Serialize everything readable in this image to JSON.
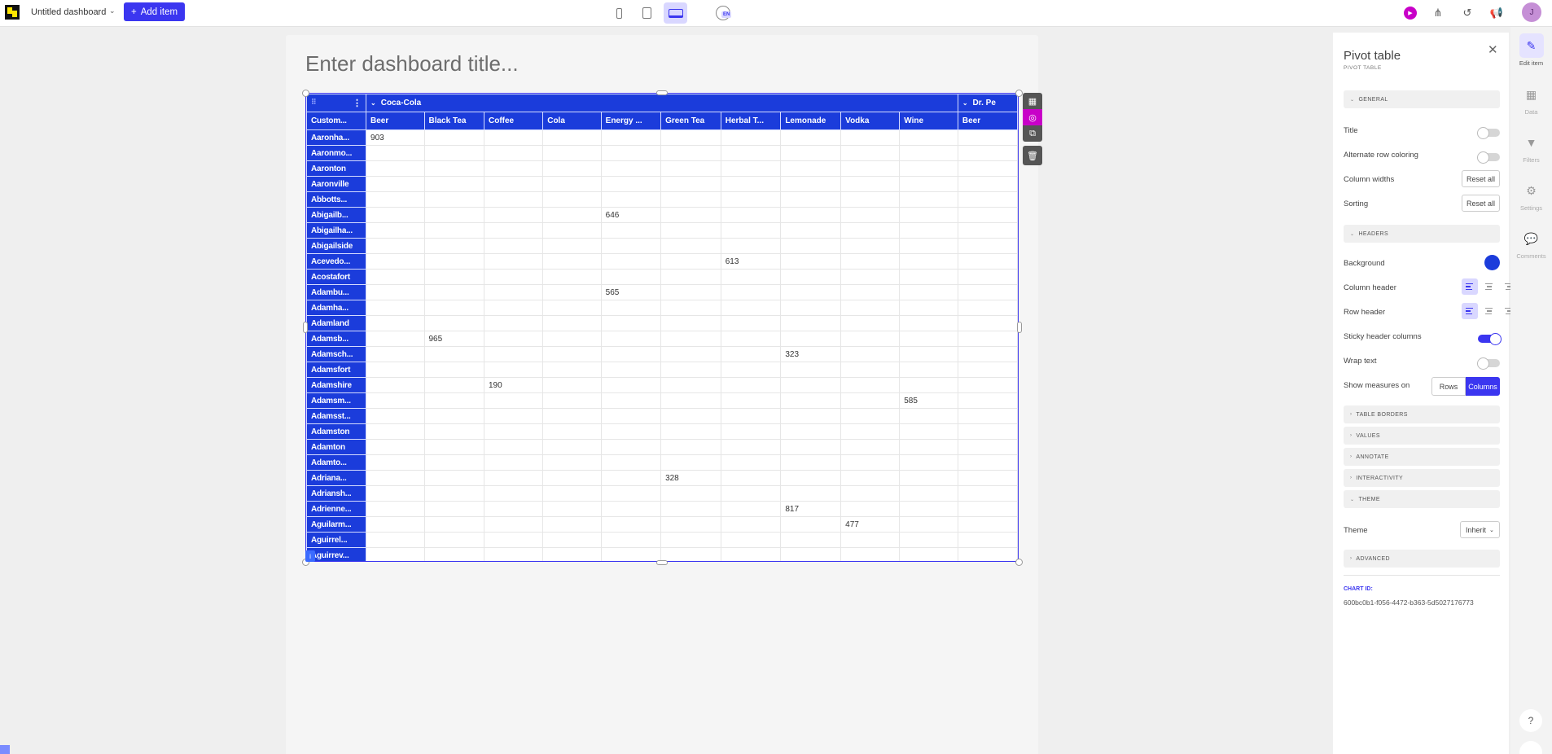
{
  "topbar": {
    "dashboard_name": "Untitled dashboard",
    "add_item_label": "Add item",
    "lang": "EN",
    "avatar_initial": "J"
  },
  "canvas": {
    "title_placeholder": "Enter dashboard title..."
  },
  "pivot": {
    "header_color": "#1b3cdb",
    "corner_label": "Custom...",
    "column_groups": [
      {
        "label": "Coca-Cola",
        "span": 10
      },
      {
        "label": "Dr. Pe",
        "span": 1
      }
    ],
    "measures": [
      "Beer",
      "Black Tea",
      "Coffee",
      "Cola",
      "Energy ...",
      "Green Tea",
      "Herbal T...",
      "Lemonade",
      "Vodka",
      "Wine",
      "Beer"
    ],
    "rows": [
      {
        "label": "Aaronha...",
        "values": [
          "903",
          "",
          "",
          "",
          "",
          "",
          "",
          "",
          "",
          "",
          ""
        ]
      },
      {
        "label": "Aaronmo...",
        "values": [
          "",
          "",
          "",
          "",
          "",
          "",
          "",
          "",
          "",
          "",
          ""
        ]
      },
      {
        "label": "Aaronton",
        "values": [
          "",
          "",
          "",
          "",
          "",
          "",
          "",
          "",
          "",
          "",
          ""
        ]
      },
      {
        "label": "Aaronville",
        "values": [
          "",
          "",
          "",
          "",
          "",
          "",
          "",
          "",
          "",
          "",
          ""
        ]
      },
      {
        "label": "Abbotts...",
        "values": [
          "",
          "",
          "",
          "",
          "",
          "",
          "",
          "",
          "",
          "",
          ""
        ]
      },
      {
        "label": "Abigailb...",
        "values": [
          "",
          "",
          "",
          "",
          "646",
          "",
          "",
          "",
          "",
          "",
          ""
        ]
      },
      {
        "label": "Abigailha...",
        "values": [
          "",
          "",
          "",
          "",
          "",
          "",
          "",
          "",
          "",
          "",
          ""
        ]
      },
      {
        "label": "Abigailside",
        "values": [
          "",
          "",
          "",
          "",
          "",
          "",
          "",
          "",
          "",
          "",
          ""
        ]
      },
      {
        "label": "Acevedo...",
        "values": [
          "",
          "",
          "",
          "",
          "",
          "",
          "613",
          "",
          "",
          "",
          ""
        ]
      },
      {
        "label": "Acostafort",
        "values": [
          "",
          "",
          "",
          "",
          "",
          "",
          "",
          "",
          "",
          "",
          ""
        ]
      },
      {
        "label": "Adambu...",
        "values": [
          "",
          "",
          "",
          "",
          "565",
          "",
          "",
          "",
          "",
          "",
          ""
        ]
      },
      {
        "label": "Adamha...",
        "values": [
          "",
          "",
          "",
          "",
          "",
          "",
          "",
          "",
          "",
          "",
          ""
        ]
      },
      {
        "label": "Adamland",
        "values": [
          "",
          "",
          "",
          "",
          "",
          "",
          "",
          "",
          "",
          "",
          ""
        ]
      },
      {
        "label": "Adamsb...",
        "values": [
          "",
          "965",
          "",
          "",
          "",
          "",
          "",
          "",
          "",
          "",
          ""
        ]
      },
      {
        "label": "Adamsch...",
        "values": [
          "",
          "",
          "",
          "",
          "",
          "",
          "",
          "323",
          "",
          "",
          ""
        ]
      },
      {
        "label": "Adamsfort",
        "values": [
          "",
          "",
          "",
          "",
          "",
          "",
          "",
          "",
          "",
          "",
          ""
        ]
      },
      {
        "label": "Adamshire",
        "values": [
          "",
          "",
          "190",
          "",
          "",
          "",
          "",
          "",
          "",
          "",
          ""
        ]
      },
      {
        "label": "Adamsm...",
        "values": [
          "",
          "",
          "",
          "",
          "",
          "",
          "",
          "",
          "",
          "585",
          ""
        ]
      },
      {
        "label": "Adamsst...",
        "values": [
          "",
          "",
          "",
          "",
          "",
          "",
          "",
          "",
          "",
          "",
          ""
        ]
      },
      {
        "label": "Adamston",
        "values": [
          "",
          "",
          "",
          "",
          "",
          "",
          "",
          "",
          "",
          "",
          ""
        ]
      },
      {
        "label": "Adamton",
        "values": [
          "",
          "",
          "",
          "",
          "",
          "",
          "",
          "",
          "",
          "",
          ""
        ]
      },
      {
        "label": "Adamto...",
        "values": [
          "",
          "",
          "",
          "",
          "",
          "",
          "",
          "",
          "",
          "",
          ""
        ]
      },
      {
        "label": "Adriana...",
        "values": [
          "",
          "",
          "",
          "",
          "",
          "328",
          "",
          "",
          "",
          "",
          ""
        ]
      },
      {
        "label": "Adriansh...",
        "values": [
          "",
          "",
          "",
          "",
          "",
          "",
          "",
          "",
          "",
          "",
          ""
        ]
      },
      {
        "label": "Adrienne...",
        "values": [
          "",
          "",
          "",
          "",
          "",
          "",
          "",
          "817",
          "",
          "",
          ""
        ]
      },
      {
        "label": "Aguilarm...",
        "values": [
          "",
          "",
          "",
          "",
          "",
          "",
          "",
          "",
          "477",
          "",
          ""
        ]
      },
      {
        "label": "Aguirrel...",
        "values": [
          "",
          "",
          "",
          "",
          "",
          "",
          "",
          "",
          "",
          "",
          ""
        ]
      },
      {
        "label": "Aguirrev...",
        "values": [
          "",
          "",
          "",
          "",
          "",
          "",
          "",
          "",
          "",
          "",
          ""
        ]
      }
    ]
  },
  "panel": {
    "title": "Pivot table",
    "subtitle": "PIVOT TABLE",
    "sections": {
      "general": "GENERAL",
      "headers": "HEADERS",
      "table_borders": "TABLE BORDERS",
      "values": "VALUES",
      "annotate": "ANNOTATE",
      "interactivity": "INTERACTIVITY",
      "theme": "THEME",
      "advanced": "ADVANCED"
    },
    "labels": {
      "title": "Title",
      "alternate_row_coloring": "Alternate row coloring",
      "column_widths": "Column widths",
      "sorting": "Sorting",
      "background": "Background",
      "column_header": "Column header",
      "row_header": "Row header",
      "sticky_header_columns": "Sticky header columns",
      "wrap_text": "Wrap text",
      "show_measures_on": "Show measures on",
      "theme": "Theme"
    },
    "reset_all": "Reset all",
    "measures_options": [
      "Rows",
      "Columns"
    ],
    "theme_value": "Inherit",
    "chart_id_label": "CHART ID:",
    "chart_id": "600bc0b1-f056-4472-b363-5d5027176773"
  },
  "rail": {
    "items": [
      "Edit item",
      "Data",
      "Filters",
      "Settings",
      "Comments"
    ],
    "help": "?"
  }
}
